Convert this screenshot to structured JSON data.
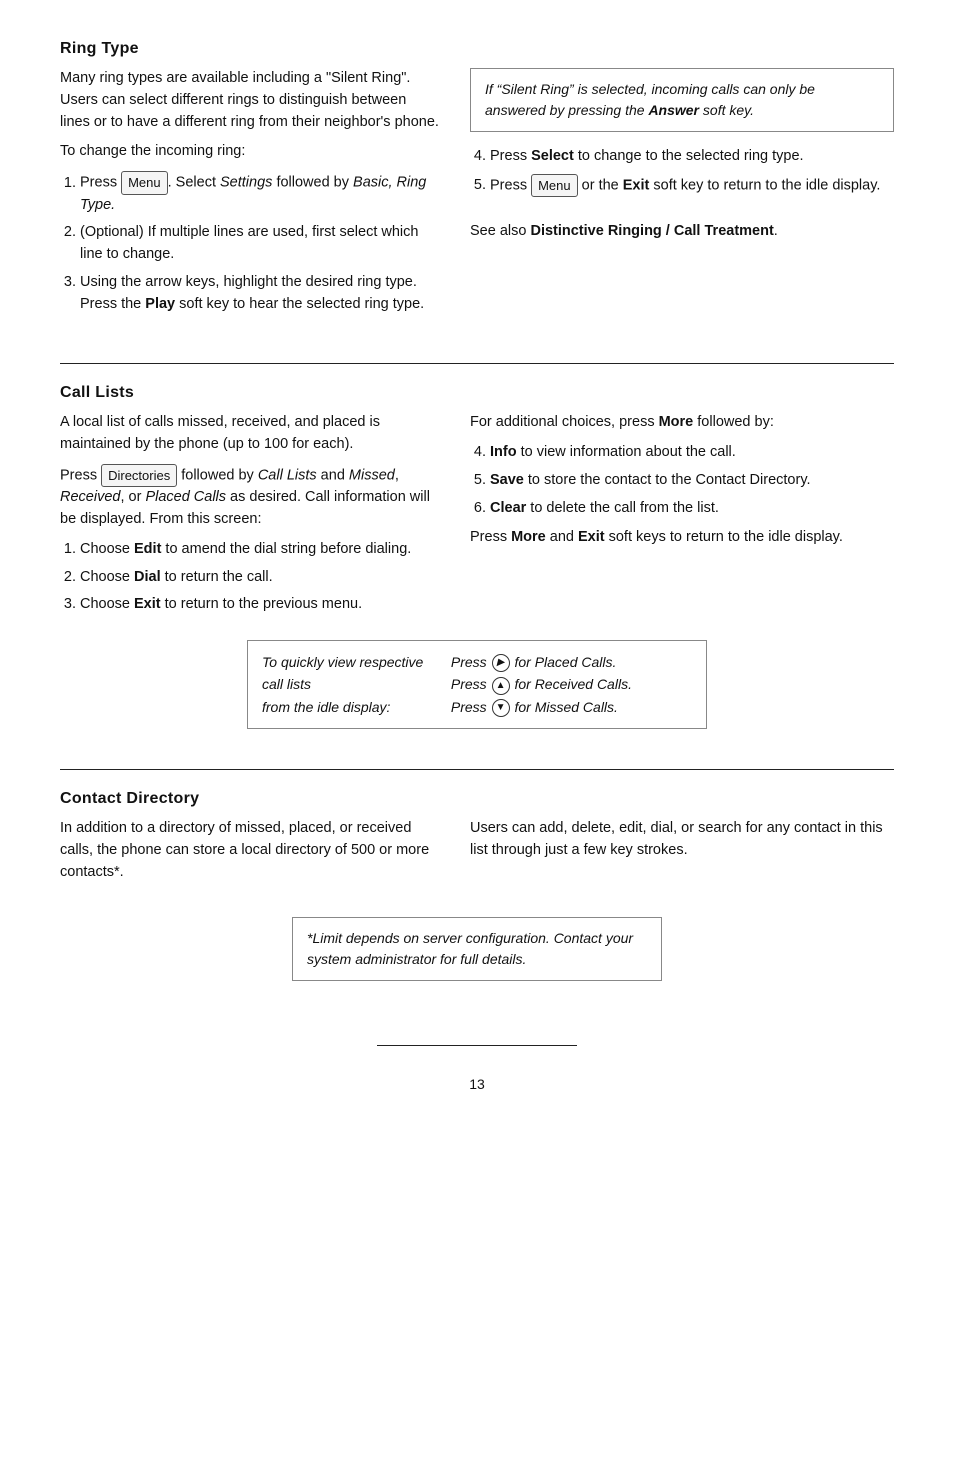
{
  "ring_type": {
    "title": "Ring Type",
    "intro": "Many ring types are available including a \"Silent Ring\".  Users can select different rings to distinguish between lines or to have a different ring from their neighbor's phone.",
    "to_change": "To change the incoming ring:",
    "steps_left": [
      {
        "id": 1,
        "parts": [
          {
            "text": "Press ",
            "type": "normal"
          },
          {
            "text": "Menu",
            "type": "key"
          },
          {
            "text": ". Select ",
            "type": "normal"
          },
          {
            "text": "Settings",
            "type": "italic"
          },
          {
            "text": " followed by ",
            "type": "normal"
          },
          {
            "text": "Basic, Ring Type.",
            "type": "italic"
          }
        ]
      },
      {
        "id": 2,
        "parts": [
          {
            "text": "(Optional)  If multiple lines are used, first select which line to change.",
            "type": "normal"
          }
        ]
      },
      {
        "id": 3,
        "parts": [
          {
            "text": "Using the arrow keys, highlight the desired ring type.  Press the ",
            "type": "normal"
          },
          {
            "text": "Play",
            "type": "bold"
          },
          {
            "text": " soft key to hear the selected ring type.",
            "type": "normal"
          }
        ]
      }
    ],
    "steps_right": [
      {
        "id": 4,
        "parts": [
          {
            "text": "Press ",
            "type": "normal"
          },
          {
            "text": "Select",
            "type": "bold"
          },
          {
            "text": " to change to the selected ring type.",
            "type": "normal"
          }
        ]
      },
      {
        "id": 5,
        "parts": [
          {
            "text": "Press ",
            "type": "normal"
          },
          {
            "text": "Menu",
            "type": "key"
          },
          {
            "text": " or the ",
            "type": "normal"
          },
          {
            "text": "Exit",
            "type": "bold"
          },
          {
            "text": " soft key to return to the idle display.",
            "type": "normal"
          }
        ]
      }
    ],
    "info_box": "If “Silent Ring” is selected, incoming calls can only be answered by pressing the Answer soft key.",
    "info_box_bold": "Answer",
    "see_also": "See also ",
    "see_also_bold": "Distinctive Ringing / Call Treatment",
    "see_also_end": "."
  },
  "call_lists": {
    "title": "Call Lists",
    "intro": "A local list of calls missed, received, and placed is maintained by the phone (up to 100 for each).",
    "press_intro_parts": [
      {
        "text": "Press ",
        "type": "normal"
      },
      {
        "text": "Directories",
        "type": "key"
      },
      {
        "text": " followed by ",
        "type": "normal"
      },
      {
        "text": "Call Lists",
        "type": "italic"
      },
      {
        "text": " and ",
        "type": "normal"
      },
      {
        "text": "Missed",
        "type": "italic"
      },
      {
        "text": ", ",
        "type": "normal"
      },
      {
        "text": "Received",
        "type": "italic"
      },
      {
        "text": ", or ",
        "type": "normal"
      },
      {
        "text": "Placed Calls",
        "type": "italic"
      },
      {
        "text": " as desired.  Call information will be displayed.  From this screen:",
        "type": "normal"
      }
    ],
    "steps_left": [
      {
        "id": 1,
        "parts": [
          {
            "text": "Choose ",
            "type": "normal"
          },
          {
            "text": "Edit",
            "type": "bold"
          },
          {
            "text": " to amend the dial string before dialing.",
            "type": "normal"
          }
        ]
      },
      {
        "id": 2,
        "parts": [
          {
            "text": "Choose ",
            "type": "normal"
          },
          {
            "text": "Dial",
            "type": "bold"
          },
          {
            "text": " to return the call.",
            "type": "normal"
          }
        ]
      },
      {
        "id": 3,
        "parts": [
          {
            "text": "Choose ",
            "type": "normal"
          },
          {
            "text": "Exit",
            "type": "bold"
          },
          {
            "text": " to return to the previous menu.",
            "type": "normal"
          }
        ]
      }
    ],
    "right_intro": "For additional choices, press ",
    "right_intro_bold": "More",
    "right_intro_end": " followed by:",
    "steps_right": [
      {
        "id": 4,
        "parts": [
          {
            "text": "Info",
            "type": "bold"
          },
          {
            "text": " to view information about the call.",
            "type": "normal"
          }
        ]
      },
      {
        "id": 5,
        "parts": [
          {
            "text": "Save",
            "type": "bold"
          },
          {
            "text": " to store the contact to the Contact Directory.",
            "type": "normal"
          }
        ]
      },
      {
        "id": 6,
        "parts": [
          {
            "text": "Clear",
            "type": "bold"
          },
          {
            "text": " to delete the call from the list.",
            "type": "normal"
          }
        ]
      }
    ],
    "exit_note_parts": [
      {
        "text": "Press ",
        "type": "normal"
      },
      {
        "text": "More",
        "type": "bold"
      },
      {
        "text": " and ",
        "type": "normal"
      },
      {
        "text": "Exit",
        "type": "bold"
      },
      {
        "text": " soft keys to return to the idle display.",
        "type": "normal"
      }
    ],
    "bottom_box": {
      "left1": "To quickly view respective call lists",
      "left2": "from the idle display:",
      "right1": "Press",
      "right1_arrow": "right",
      "right1_end": "for Placed Calls.",
      "right2": "Press",
      "right2_arrow": "up",
      "right2_end": "for Received Calls.",
      "right3": "Press",
      "right3_arrow": "down",
      "right3_end": "for Missed Calls."
    }
  },
  "contact_directory": {
    "title": "Contact Directory",
    "left_text": "In addition to a directory of missed, placed, or received calls, the phone can store a local directory of 500 or more contacts*.",
    "right_text": "Users can add, delete, edit, dial, or search for any contact in this list through just a few key strokes.",
    "info_box": "*Limit depends on server configuration. Contact your system administrator for full details."
  },
  "page_number": "13",
  "icons": {
    "menu": "Menu",
    "directories": "Directories",
    "arrow_right": "▶",
    "arrow_up": "▲",
    "arrow_down": "▼"
  }
}
